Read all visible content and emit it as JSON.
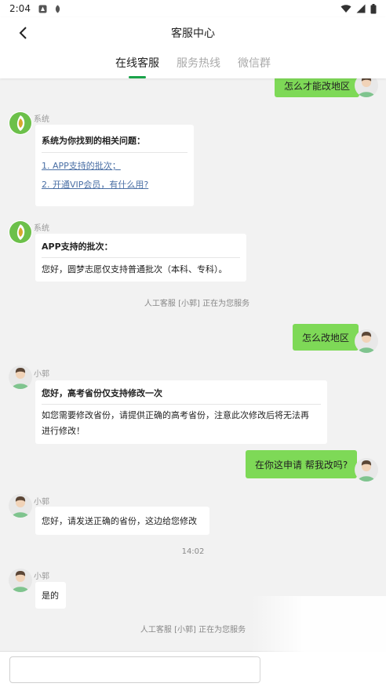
{
  "status_bar": {
    "time": "2:04"
  },
  "header": {
    "title": "客服中心",
    "tabs": [
      "在线客服",
      "服务热线",
      "微信群"
    ]
  },
  "chat": {
    "msg_top_right": "怎么才能改地区",
    "sys1": {
      "name": "系统",
      "heading": "系统为你找到的相关问题：",
      "links": [
        "1. APP支持的批次；",
        "2. 开通VIP会员，有什么用?"
      ]
    },
    "sys2": {
      "name": "系统",
      "heading": "APP支持的批次：",
      "body": "您好，圆梦志愿仅支持普通批次（本科、专科）。"
    },
    "notice1": "人工客服 [小郭] 正在为您服务",
    "msg_user2": "怎么改地区",
    "agent1": {
      "name": "小郭",
      "heading": "您好，高考省份仅支持修改一次",
      "body_line1": "如您需要修改省份，请提供正确的高考省份，注意此次修改后将无法再",
      "body_line2": "进行修改！"
    },
    "msg_user3": "在你这申请 帮我改吗?",
    "agent2": {
      "name": "小郭",
      "body": "您好，请发送正确的省份，这边给您修改"
    },
    "timestamp": "14:02",
    "agent3": {
      "name": "小郭",
      "body": "是的"
    },
    "notice2": "人工客服 [小郭] 正在为您服务"
  },
  "input": {
    "placeholder": ""
  },
  "colors": {
    "accent": "#1aa34a",
    "user_bubble": "#7ed957",
    "link": "#4a6fa5"
  }
}
